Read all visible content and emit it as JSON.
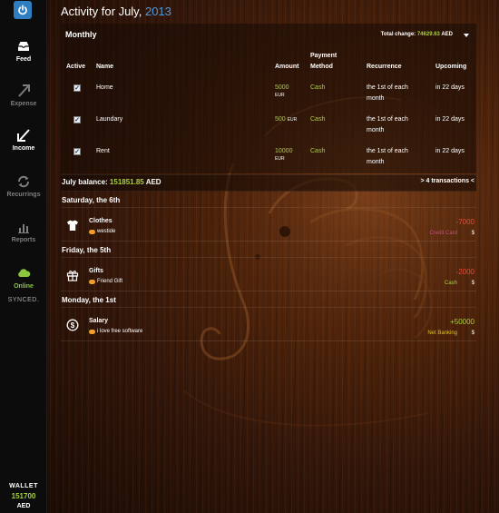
{
  "sidebar": {
    "items": [
      {
        "label": "Feed",
        "icon": "inbox-tray-icon"
      },
      {
        "label": "Expense",
        "icon": "arrow-up-right-icon"
      },
      {
        "label": "Income",
        "icon": "arrow-down-left-icon"
      },
      {
        "label": "Recurrings",
        "icon": "refresh-icon"
      },
      {
        "label": "Reports",
        "icon": "bar-chart-icon"
      },
      {
        "label": "Online",
        "icon": "cloud-icon"
      }
    ],
    "synced": "SYNCED.",
    "wallet": {
      "label": "WALLET",
      "amount": "151700",
      "currency": "AED"
    }
  },
  "header": {
    "title": "Activity for July,",
    "year": "2013"
  },
  "monthly": {
    "heading": "Monthly",
    "total_change_label": "Total change:",
    "total_change_value": "74629.63",
    "total_change_currency": "AED",
    "columns": {
      "active": "Active",
      "name": "Name",
      "amount": "Amount",
      "payment_method_1": "Payment",
      "payment_method_2": "Method",
      "recurrence": "Recurrence",
      "upcoming": "Upcoming"
    },
    "rows": [
      {
        "active": true,
        "name": "Home",
        "amount": "5000",
        "currency": "EUR",
        "method": "Cash",
        "recurrence_1": "the 1st of each",
        "recurrence_2": "month",
        "upcoming": "in 22 days"
      },
      {
        "active": true,
        "name": "Laundary",
        "amount": "500",
        "currency": "EUR",
        "method": "Cash",
        "recurrence_1": "the 1st of each",
        "recurrence_2": "month",
        "upcoming": "in 22 days"
      },
      {
        "active": true,
        "name": "Rent",
        "amount": "10000",
        "currency": "EUR",
        "method": "Cash",
        "recurrence_1": "the 1st of each",
        "recurrence_2": "month",
        "upcoming": "in 22 days"
      }
    ]
  },
  "balance": {
    "label": "July balance:",
    "value": "151851.85",
    "currency": "AED",
    "transactions": "> 4 transactions <"
  },
  "days": [
    {
      "label": "Saturday, the 6th"
    },
    {
      "label": "Friday, the 5th"
    },
    {
      "label": "Monday, the 1st"
    }
  ],
  "transactions": [
    {
      "name": "Clothes",
      "note": "westide",
      "amount": "-7000",
      "method": "Credit Card",
      "currency": "$",
      "icon": "tshirt-icon"
    },
    {
      "name": "Gifts",
      "note": "Friend Gift",
      "amount": "-2000",
      "method": "Cash",
      "currency": "$",
      "icon": "gift-icon"
    },
    {
      "name": "Salary",
      "note": "i love free software",
      "amount": "+50000",
      "method": "Net Banking",
      "currency": "$",
      "icon": "dollar-coin-icon"
    }
  ],
  "colors": {
    "accent_blue": "#2f7ec2",
    "positive_green": "#a6d13a",
    "negative_red": "#e84a3a",
    "credit_card_pink": "#c0507e",
    "net_banking_yellow": "#e0c020"
  }
}
